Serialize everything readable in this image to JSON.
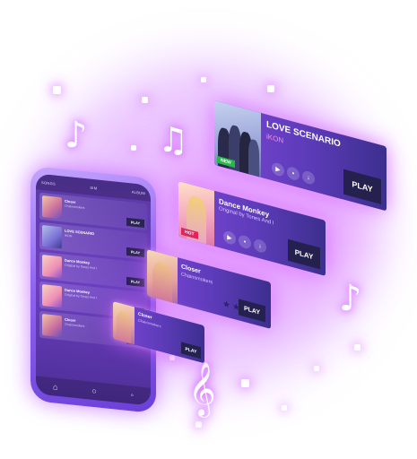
{
  "phone": {
    "tab_left": "SONGS",
    "tab_mid": "SIM",
    "tab_right": "ALBUM",
    "rows": [
      {
        "title": "Closer",
        "sub": "Chainsmokers",
        "play": "PLAY"
      },
      {
        "title": "LOVE SCENARIO",
        "sub": "iKON",
        "play": "PLAY"
      },
      {
        "title": "Dance Monkey",
        "sub": "Original by Tones And I",
        "play": "PLAY"
      },
      {
        "title": "Dance Monkey",
        "sub": "Original by Tones And I",
        "play": "PLAY"
      },
      {
        "title": "Closer",
        "sub": "Chainsmokers",
        "play": "PLAY"
      }
    ],
    "home_icon": "home-icon"
  },
  "cards": [
    {
      "title": "LOVE SCENARIO",
      "subtitle": "iKON",
      "badge": "NEW",
      "badge_color": "#27b84a",
      "play": "PLAY"
    },
    {
      "title": "Dance Monkey",
      "subtitle": "Original by Tones And I",
      "badge": "HOT",
      "badge_color": "#e0245e",
      "play": "PLAY"
    },
    {
      "title": "Closer",
      "subtitle": "Chainsmokers",
      "badge": "",
      "badge_color": "",
      "play": "PLAY"
    },
    {
      "title": "Closer",
      "subtitle": "Chainsmokers",
      "badge": "",
      "badge_color": "",
      "play": "PLAY"
    }
  ],
  "colors": {
    "accent_glow": "#c85bff",
    "card_dark": "#3c2f8e",
    "play_button": "#25214f"
  }
}
